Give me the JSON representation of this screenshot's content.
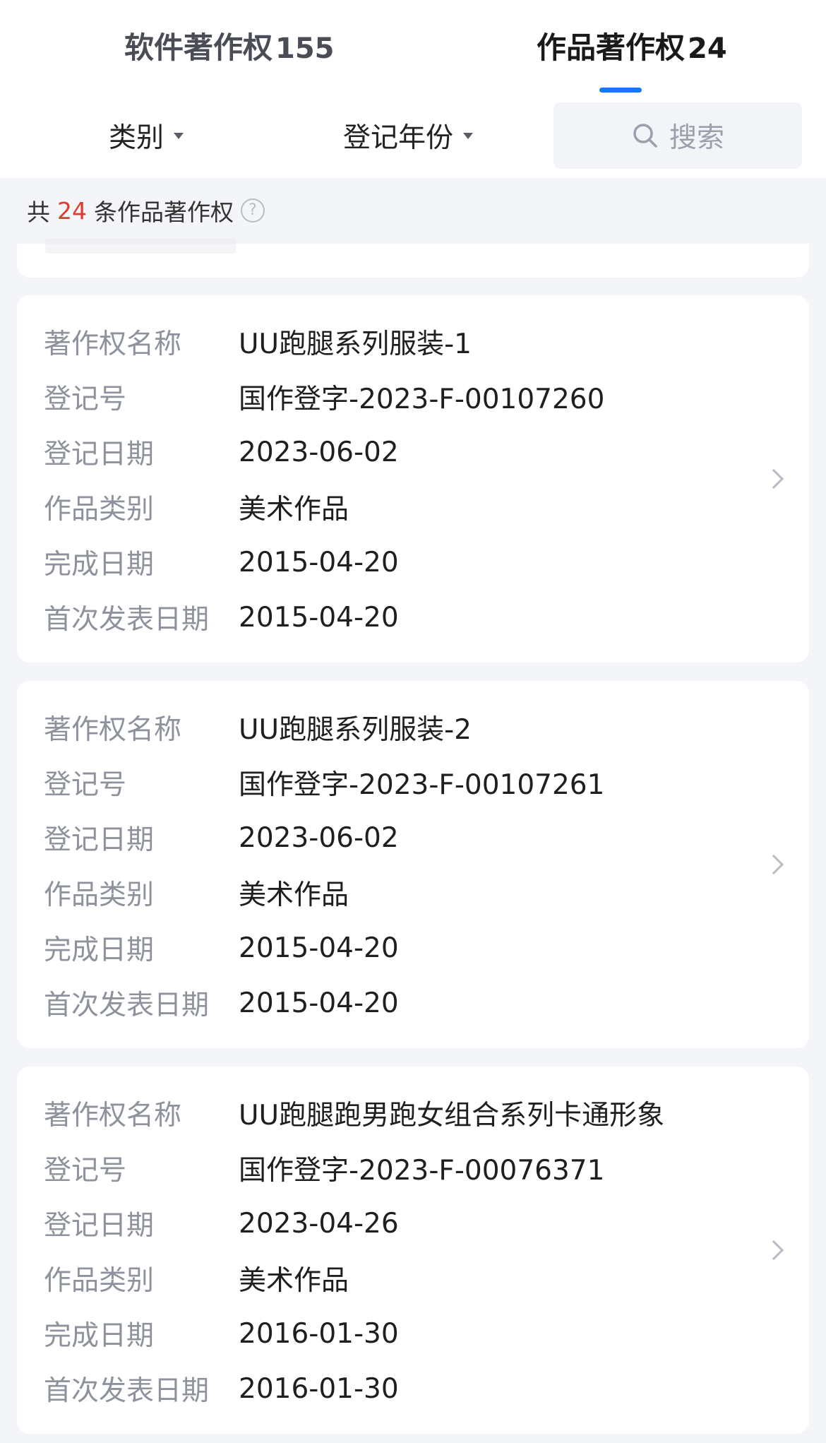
{
  "tabs": {
    "software": {
      "label": "软件著作权",
      "count": "155"
    },
    "works": {
      "label": "作品著作权",
      "count": "24"
    }
  },
  "filters": {
    "category": "类别",
    "year": "登记年份",
    "search_placeholder": "搜索"
  },
  "summary": {
    "prefix": "共",
    "count": "24",
    "suffix": "条作品著作权"
  },
  "field_labels": {
    "name": "著作权名称",
    "reg_no": "登记号",
    "reg_date": "登记日期",
    "category": "作品类别",
    "completion_date": "完成日期",
    "first_publish_date": "首次发表日期"
  },
  "records": [
    {
      "name": "UU跑腿系列服装-1",
      "reg_no": "国作登字-2023-F-00107260",
      "reg_date": "2023-06-02",
      "category": "美术作品",
      "completion_date": "2015-04-20",
      "first_publish_date": "2015-04-20"
    },
    {
      "name": "UU跑腿系列服装-2",
      "reg_no": "国作登字-2023-F-00107261",
      "reg_date": "2023-06-02",
      "category": "美术作品",
      "completion_date": "2015-04-20",
      "first_publish_date": "2015-04-20"
    },
    {
      "name": "UU跑腿跑男跑女组合系列卡通形象",
      "reg_no": "国作登字-2023-F-00076371",
      "reg_date": "2023-04-26",
      "category": "美术作品",
      "completion_date": "2016-01-30",
      "first_publish_date": "2016-01-30"
    }
  ],
  "colors": {
    "accent": "#1677ff",
    "count_highlight": "#e03a2e",
    "label_gray": "#8d929c"
  }
}
